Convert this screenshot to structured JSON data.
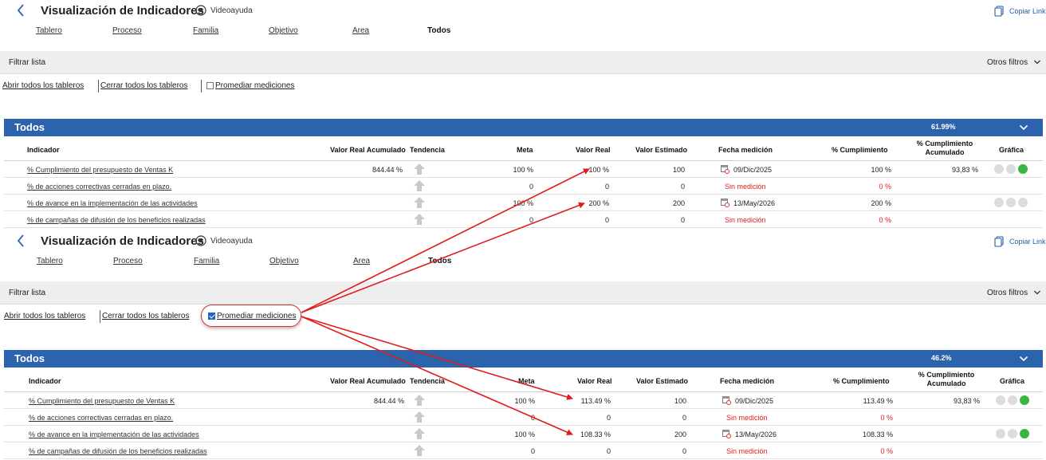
{
  "colors": {
    "accent": "#2b64ad",
    "alert": "#e02020",
    "good": "#38b63f",
    "annotation": "#e01b1b"
  },
  "panels": [
    {
      "header": {
        "title": "Visualización de Indicadores",
        "video_label": "Videoayuda",
        "copy_label": "Copiar Link"
      },
      "tabs": [
        {
          "label": "Tablero",
          "active": false
        },
        {
          "label": "Proceso",
          "active": false
        },
        {
          "label": "Familia",
          "active": false
        },
        {
          "label": "Objetivo",
          "active": false
        },
        {
          "label": "Area",
          "active": false
        },
        {
          "label": "Todos",
          "active": true
        }
      ],
      "filter": {
        "label": "Filtrar lista",
        "other_filters": "Otros filtros"
      },
      "actions": {
        "open_all": "Abrir todos los tableros",
        "close_all": "Cerrar todos los tableros",
        "average_label": "Promediar mediciones",
        "average_checked": false
      },
      "group": {
        "title": "Todos",
        "percent": "61.99%"
      },
      "columns": [
        "Indicador",
        "Valor Real Acumulado",
        "Tendencia",
        "Meta",
        "Valor Real",
        "Valor Estimado",
        "Fecha medición",
        "% Cumplimiento",
        "% Cumplimiento Acumulado",
        "Gráfica"
      ],
      "rows": [
        {
          "indicator": "% Cumplimiento del presupuesto de Ventas K",
          "accum": "844.44 %",
          "trend": "up-arrow-icon",
          "meta": "100 %",
          "real": "100 %",
          "estimated": "100",
          "date": "09/Dic/2025",
          "has_date": true,
          "compliance": "100 %",
          "compliance_red": false,
          "compliance_accum": "93,83 %",
          "dots": [
            "grey",
            "grey",
            "green"
          ]
        },
        {
          "indicator": "% de acciones correctivas cerradas en plazo.",
          "accum": "",
          "trend": "up-arrow-icon",
          "meta": "0",
          "real": "0",
          "estimated": "0",
          "date": "Sin medición",
          "has_date": false,
          "compliance": "0 %",
          "compliance_red": true,
          "compliance_accum": "",
          "dots": []
        },
        {
          "indicator": "% de avance en la implementación de las actividades",
          "accum": "",
          "trend": "up-arrow-icon",
          "meta": "100 %",
          "real": "200 %",
          "estimated": "200",
          "date": "13/May/2026",
          "has_date": true,
          "compliance": "200 %",
          "compliance_red": false,
          "compliance_accum": "",
          "dots": [
            "grey",
            "grey",
            "grey"
          ]
        },
        {
          "indicator": "% de campañas de difusión de los beneficios realizadas",
          "accum": "",
          "trend": "up-arrow-icon",
          "meta": "0",
          "real": "0",
          "estimated": "0",
          "date": "Sin medición",
          "has_date": false,
          "compliance": "0 %",
          "compliance_red": true,
          "compliance_accum": "",
          "dots": []
        }
      ]
    },
    {
      "header": {
        "title": "Visualización de Indicadores",
        "video_label": "Videoayuda",
        "copy_label": "Copiar Link"
      },
      "tabs": [
        {
          "label": "Tablero",
          "active": false
        },
        {
          "label": "Proceso",
          "active": false
        },
        {
          "label": "Familia",
          "active": false
        },
        {
          "label": "Objetivo",
          "active": false
        },
        {
          "label": "Area",
          "active": false
        },
        {
          "label": "Todos",
          "active": true
        }
      ],
      "filter": {
        "label": "Filtrar lista",
        "other_filters": "Otros filtros"
      },
      "actions": {
        "open_all": "Abrir todos los tableros",
        "close_all": "Cerrar todos los tableros",
        "average_label": "Promediar mediciones",
        "average_checked": true
      },
      "group": {
        "title": "Todos",
        "percent": "46.2%"
      },
      "columns": [
        "Indicador",
        "Valor Real Acumulado",
        "Tendencia",
        "Meta",
        "Valor Real",
        "Valor Estimado",
        "Fecha medición",
        "% Cumplimiento",
        "% Cumplimiento Acumulado",
        "Gráfica"
      ],
      "rows": [
        {
          "indicator": "% Cumplimiento del presupuesto de Ventas K",
          "accum": "844.44 %",
          "trend": "up-arrow-icon",
          "meta": "100 %",
          "real": "113.49 %",
          "estimated": "100",
          "date": "09/Dic/2025",
          "has_date": true,
          "compliance": "113.49 %",
          "compliance_red": false,
          "compliance_accum": "93,83 %",
          "dots": [
            "grey",
            "grey",
            "green"
          ]
        },
        {
          "indicator": "% de acciones correctivas cerradas en plazo.",
          "accum": "",
          "trend": "up-arrow-icon",
          "meta": "0",
          "real": "0",
          "estimated": "0",
          "date": "Sin medición",
          "has_date": false,
          "compliance": "0 %",
          "compliance_red": true,
          "compliance_accum": "",
          "dots": []
        },
        {
          "indicator": "% de avance en la implementación de las actividades",
          "accum": "",
          "trend": "up-arrow-icon",
          "meta": "100 %",
          "real": "108.33 %",
          "estimated": "200",
          "date": "13/May/2026",
          "has_date": true,
          "compliance": "108.33 %",
          "compliance_red": false,
          "compliance_accum": "",
          "dots": [
            "grey",
            "grey",
            "green"
          ]
        },
        {
          "indicator": "% de campañas de difusión de los beneficios realizadas",
          "accum": "",
          "trend": "up-arrow-icon",
          "meta": "0",
          "real": "0",
          "estimated": "0",
          "date": "Sin medición",
          "has_date": false,
          "compliance": "0 %",
          "compliance_red": true,
          "compliance_accum": "",
          "dots": []
        }
      ]
    }
  ]
}
